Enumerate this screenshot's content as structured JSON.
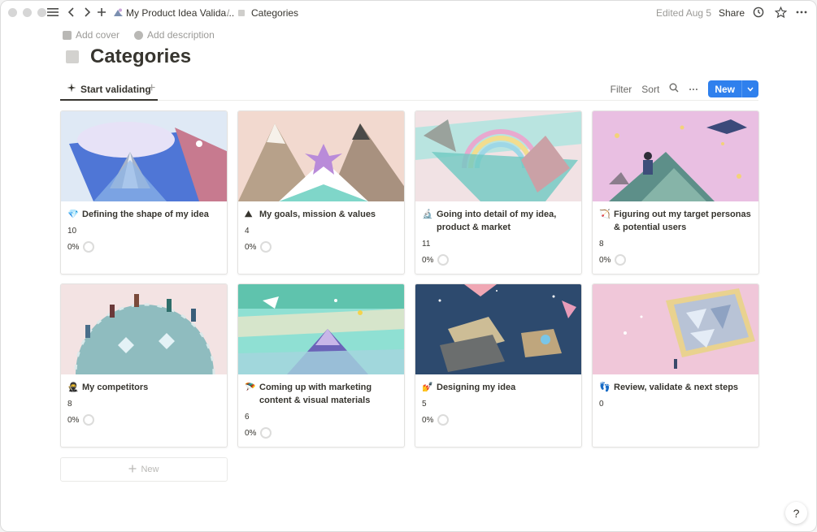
{
  "breadcrumb": {
    "workspace": "My Product Idea Valida...",
    "separator": "/",
    "current": "Categories"
  },
  "topbar": {
    "edited": "Edited Aug 5",
    "share": "Share"
  },
  "page_actions": {
    "add_cover": "Add cover",
    "add_description": "Add description"
  },
  "page": {
    "title": "Categories"
  },
  "view": {
    "tab_label": "Start validating",
    "add": "+",
    "filter": "Filter",
    "sort": "Sort",
    "more": "···",
    "new": "New"
  },
  "cards": [
    {
      "emoji": "💎",
      "title": "Defining the shape of my idea",
      "count": "10",
      "progress": "0%"
    },
    {
      "emoji": "⛰",
      "title": "My goals, mission & values",
      "count": "4",
      "progress": "0%"
    },
    {
      "emoji": "🔬",
      "title": "Going into detail of my idea, product & market",
      "count": "11",
      "progress": "0%"
    },
    {
      "emoji": "🏹",
      "title": "Figuring out my target personas & potential users",
      "count": "8",
      "progress": "0%"
    },
    {
      "emoji": "🥷",
      "title": "My competitors",
      "count": "8",
      "progress": "0%"
    },
    {
      "emoji": "🪂",
      "title": "Coming up with marketing content & visual materials",
      "count": "6",
      "progress": "0%"
    },
    {
      "emoji": "💅",
      "title": "Designing my idea",
      "count": "5",
      "progress": "0%"
    },
    {
      "emoji": "👣",
      "title": "Review, validate & next steps",
      "count": "0",
      "progress": ""
    }
  ],
  "new_card": "New",
  "help": "?",
  "colors": {
    "accent": "#2f80ed",
    "text": "#37352f",
    "muted": "#9b9a97"
  }
}
